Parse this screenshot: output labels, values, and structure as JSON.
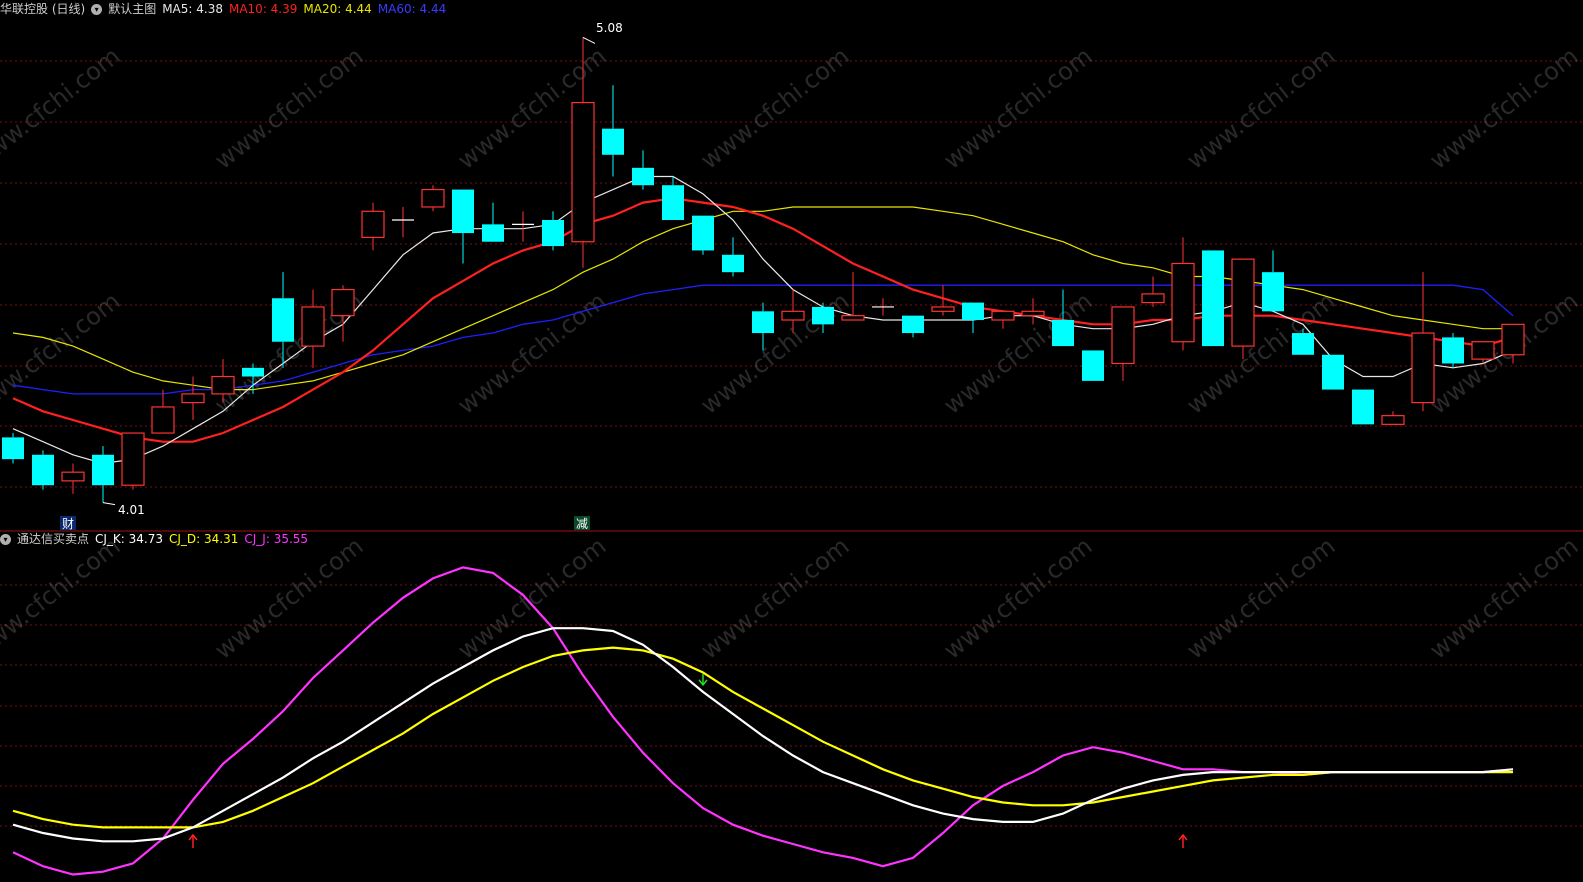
{
  "header_main": {
    "stock": "华联控股 (日线)",
    "main_chart_label": "默认主图",
    "ma5": "MA5: 4.38",
    "ma10": "MA10: 4.39",
    "ma20": "MA20: 4.44",
    "ma60": "MA60: 4.44"
  },
  "header_sub": {
    "indicator": "通达信买卖点",
    "k": "CJ_K: 34.73",
    "d": "CJ_D: 34.31",
    "j": "CJ_J: 35.55"
  },
  "colors": {
    "bg": "#000000",
    "up": "#ff3333",
    "down": "#00ffff",
    "grid": "#7a1010",
    "ma5": "#e8e8e8",
    "ma10": "#ff2020",
    "ma20": "#e6e600",
    "ma60": "#1f1fff",
    "k": "#ffffff",
    "d": "#ffff00",
    "j": "#ff33ff"
  },
  "annotations": {
    "high_label": "5.08",
    "low_label": "4.01",
    "marker_cai": "财",
    "marker_jian": "减"
  },
  "watermark": "www.cfchi.com",
  "chart_data": [
    {
      "type": "candlestick",
      "title": "华联控股 (日线)",
      "ylim": [
        3.97,
        5.12
      ],
      "candles": [
        {
          "o": 4.16,
          "h": 4.17,
          "l": 4.1,
          "c": 4.11
        },
        {
          "o": 4.12,
          "h": 4.13,
          "l": 4.04,
          "c": 4.05
        },
        {
          "o": 4.06,
          "h": 4.1,
          "l": 4.03,
          "c": 4.08
        },
        {
          "o": 4.12,
          "h": 4.14,
          "l": 4.01,
          "c": 4.05
        },
        {
          "o": 4.05,
          "h": 4.17,
          "l": 4.04,
          "c": 4.17
        },
        {
          "o": 4.17,
          "h": 4.27,
          "l": 4.17,
          "c": 4.23
        },
        {
          "o": 4.24,
          "h": 4.3,
          "l": 4.2,
          "c": 4.26
        },
        {
          "o": 4.26,
          "h": 4.34,
          "l": 4.24,
          "c": 4.3
        },
        {
          "o": 4.32,
          "h": 4.33,
          "l": 4.26,
          "c": 4.3
        },
        {
          "o": 4.48,
          "h": 4.54,
          "l": 4.32,
          "c": 4.38
        },
        {
          "o": 4.37,
          "h": 4.5,
          "l": 4.32,
          "c": 4.46
        },
        {
          "o": 4.44,
          "h": 4.51,
          "l": 4.38,
          "c": 4.5
        },
        {
          "o": 4.62,
          "h": 4.7,
          "l": 4.59,
          "c": 4.68
        },
        {
          "o": 4.66,
          "h": 4.69,
          "l": 4.62,
          "c": 4.66
        },
        {
          "o": 4.69,
          "h": 4.74,
          "l": 4.68,
          "c": 4.73
        },
        {
          "o": 4.73,
          "h": 4.73,
          "l": 4.56,
          "c": 4.63
        },
        {
          "o": 4.65,
          "h": 4.7,
          "l": 4.61,
          "c": 4.61
        },
        {
          "o": 4.65,
          "h": 4.68,
          "l": 4.61,
          "c": 4.65
        },
        {
          "o": 4.66,
          "h": 4.68,
          "l": 4.59,
          "c": 4.6
        },
        {
          "o": 4.61,
          "h": 5.08,
          "l": 4.55,
          "c": 4.93
        },
        {
          "o": 4.87,
          "h": 4.97,
          "l": 4.76,
          "c": 4.81
        },
        {
          "o": 4.78,
          "h": 4.82,
          "l": 4.73,
          "c": 4.74
        },
        {
          "o": 4.74,
          "h": 4.76,
          "l": 4.66,
          "c": 4.66
        },
        {
          "o": 4.67,
          "h": 4.67,
          "l": 4.58,
          "c": 4.59
        },
        {
          "o": 4.58,
          "h": 4.62,
          "l": 4.53,
          "c": 4.54
        },
        {
          "o": 4.45,
          "h": 4.47,
          "l": 4.36,
          "c": 4.4
        },
        {
          "o": 4.43,
          "h": 4.5,
          "l": 4.4,
          "c": 4.45
        },
        {
          "o": 4.46,
          "h": 4.47,
          "l": 4.4,
          "c": 4.42
        },
        {
          "o": 4.43,
          "h": 4.54,
          "l": 4.43,
          "c": 4.44
        },
        {
          "o": 4.46,
          "h": 4.48,
          "l": 4.44,
          "c": 4.46
        },
        {
          "o": 4.44,
          "h": 4.44,
          "l": 4.39,
          "c": 4.4
        },
        {
          "o": 4.45,
          "h": 4.51,
          "l": 4.44,
          "c": 4.46
        },
        {
          "o": 4.47,
          "h": 4.47,
          "l": 4.4,
          "c": 4.43
        },
        {
          "o": 4.43,
          "h": 4.45,
          "l": 4.41,
          "c": 4.45
        },
        {
          "o": 4.44,
          "h": 4.48,
          "l": 4.42,
          "c": 4.45
        },
        {
          "o": 4.43,
          "h": 4.5,
          "l": 4.37,
          "c": 4.37
        },
        {
          "o": 4.36,
          "h": 4.36,
          "l": 4.29,
          "c": 4.29
        },
        {
          "o": 4.33,
          "h": 4.46,
          "l": 4.29,
          "c": 4.46
        },
        {
          "o": 4.47,
          "h": 4.53,
          "l": 4.46,
          "c": 4.49
        },
        {
          "o": 4.38,
          "h": 4.62,
          "l": 4.36,
          "c": 4.56
        },
        {
          "o": 4.59,
          "h": 4.59,
          "l": 4.37,
          "c": 4.37
        },
        {
          "o": 4.37,
          "h": 4.57,
          "l": 4.34,
          "c": 4.57
        },
        {
          "o": 4.54,
          "h": 4.59,
          "l": 4.45,
          "c": 4.45
        },
        {
          "o": 4.4,
          "h": 4.41,
          "l": 4.35,
          "c": 4.35
        },
        {
          "o": 4.35,
          "h": 4.35,
          "l": 4.27,
          "c": 4.27
        },
        {
          "o": 4.27,
          "h": 4.27,
          "l": 4.19,
          "c": 4.19
        },
        {
          "o": 4.19,
          "h": 4.22,
          "l": 4.19,
          "c": 4.21
        },
        {
          "o": 4.24,
          "h": 4.54,
          "l": 4.22,
          "c": 4.4
        },
        {
          "o": 4.39,
          "h": 4.4,
          "l": 4.32,
          "c": 4.33
        },
        {
          "o": 4.34,
          "h": 4.38,
          "l": 4.33,
          "c": 4.38
        },
        {
          "o": 4.35,
          "h": 4.42,
          "l": 4.33,
          "c": 4.42
        }
      ],
      "ma5": [
        4.18,
        4.15,
        4.12,
        4.1,
        4.11,
        4.14,
        4.18,
        4.22,
        4.28,
        4.33,
        4.38,
        4.42,
        4.5,
        4.58,
        4.63,
        4.64,
        4.64,
        4.64,
        4.65,
        4.7,
        4.73,
        4.76,
        4.76,
        4.72,
        4.66,
        4.57,
        4.5,
        4.46,
        4.44,
        4.43,
        4.43,
        4.43,
        4.43,
        4.44,
        4.44,
        4.42,
        4.41,
        4.41,
        4.42,
        4.44,
        4.45,
        4.47,
        4.45,
        4.42,
        4.34,
        4.3,
        4.3,
        4.33,
        4.32,
        4.33,
        4.36
      ],
      "ma10": [
        4.25,
        4.22,
        4.2,
        4.18,
        4.16,
        4.15,
        4.15,
        4.17,
        4.2,
        4.23,
        4.27,
        4.31,
        4.36,
        4.42,
        4.48,
        4.52,
        4.56,
        4.59,
        4.61,
        4.65,
        4.67,
        4.7,
        4.71,
        4.7,
        4.69,
        4.67,
        4.64,
        4.6,
        4.56,
        4.53,
        4.5,
        4.48,
        4.46,
        4.45,
        4.44,
        4.43,
        4.42,
        4.42,
        4.43,
        4.43,
        4.44,
        4.44,
        4.44,
        4.43,
        4.42,
        4.41,
        4.4,
        4.39,
        4.38,
        4.37,
        4.39
      ],
      "ma20": [
        4.4,
        4.39,
        4.37,
        4.34,
        4.31,
        4.29,
        4.28,
        4.27,
        4.27,
        4.28,
        4.29,
        4.31,
        4.33,
        4.35,
        4.38,
        4.41,
        4.44,
        4.47,
        4.5,
        4.54,
        4.57,
        4.61,
        4.64,
        4.66,
        4.68,
        4.68,
        4.69,
        4.69,
        4.69,
        4.69,
        4.69,
        4.68,
        4.67,
        4.65,
        4.63,
        4.61,
        4.58,
        4.56,
        4.55,
        4.53,
        4.53,
        4.52,
        4.51,
        4.5,
        4.48,
        4.46,
        4.44,
        4.43,
        4.42,
        4.41,
        4.41
      ],
      "ma60": [
        4.28,
        4.27,
        4.26,
        4.26,
        4.26,
        4.26,
        4.27,
        4.27,
        4.28,
        4.29,
        4.31,
        4.33,
        4.35,
        4.36,
        4.37,
        4.39,
        4.4,
        4.42,
        4.43,
        4.45,
        4.47,
        4.49,
        4.5,
        4.51,
        4.51,
        4.51,
        4.51,
        4.51,
        4.51,
        4.51,
        4.51,
        4.51,
        4.51,
        4.51,
        4.51,
        4.51,
        4.51,
        4.51,
        4.51,
        4.51,
        4.51,
        4.51,
        4.51,
        4.51,
        4.51,
        4.51,
        4.51,
        4.51,
        4.51,
        4.5,
        4.44
      ]
    },
    {
      "type": "line",
      "title": "通达信买卖点",
      "ylim": [
        -5,
        115
      ],
      "series": [
        {
          "name": "CJ_K",
          "values": [
            15,
            12,
            10,
            9,
            9,
            10,
            14,
            20,
            26,
            32,
            39,
            45,
            52,
            59,
            66,
            72,
            78,
            83,
            86,
            86,
            85,
            80,
            72,
            63,
            55,
            47,
            40,
            34,
            30,
            26,
            22,
            19,
            17,
            16,
            16,
            19,
            24,
            28,
            31,
            33,
            34,
            34,
            34,
            34,
            34,
            34,
            34,
            34,
            34,
            34,
            35
          ]
        },
        {
          "name": "CJ_D",
          "values": [
            20,
            17,
            15,
            14,
            14,
            14,
            14,
            16,
            20,
            25,
            30,
            36,
            42,
            48,
            55,
            61,
            67,
            72,
            76,
            78,
            79,
            78,
            75,
            70,
            63,
            57,
            51,
            45,
            40,
            35,
            31,
            28,
            25,
            23,
            22,
            22,
            23,
            25,
            27,
            29,
            31,
            32,
            33,
            33,
            34,
            34,
            34,
            34,
            34,
            34,
            34
          ]
        },
        {
          "name": "CJ_J",
          "values": [
            5,
            0,
            -3,
            -2,
            1,
            10,
            24,
            37,
            46,
            56,
            68,
            78,
            88,
            97,
            104,
            108,
            106,
            98,
            86,
            69,
            54,
            41,
            30,
            21,
            15,
            11,
            8,
            5,
            3,
            0,
            3,
            12,
            22,
            29,
            34,
            40,
            43,
            41,
            38,
            35,
            35,
            34,
            34,
            33,
            34,
            34,
            34,
            34,
            34,
            34,
            35
          ]
        }
      ],
      "signals": [
        {
          "index": 6,
          "type": "buy"
        },
        {
          "index": 23,
          "type": "sell"
        },
        {
          "index": 39,
          "type": "buy"
        }
      ]
    }
  ]
}
